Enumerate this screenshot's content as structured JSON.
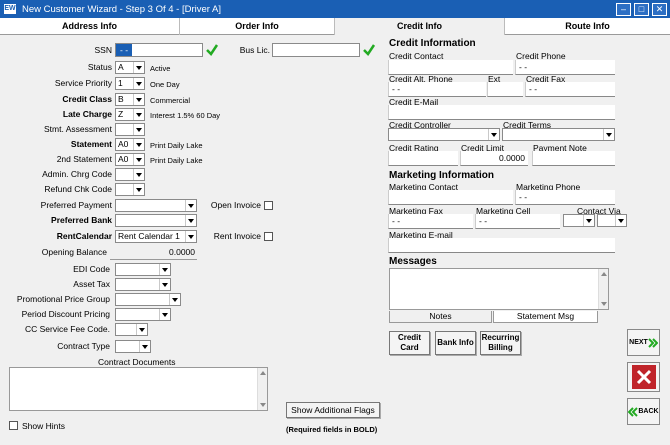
{
  "window": {
    "title": "New Customer Wizard - Step 3 Of 4 - [Driver A]",
    "app_icon": "EW",
    "colors": {
      "titlebar": "#1a5fb4",
      "check": "#22aa22",
      "close": "#c0242a"
    }
  },
  "tabs": [
    "Address Info",
    "Order Info",
    "Credit Info",
    "Route Info"
  ],
  "left": {
    "ssn_label": "SSN",
    "ssn_value": "- -",
    "bus_lic_label": "Bus Lic.",
    "status": {
      "label": "Status",
      "value": "A",
      "desc": "Active"
    },
    "service_priority": {
      "label": "Service Priority",
      "value": "1",
      "desc": "One Day"
    },
    "credit_class": {
      "label": "Credit Class",
      "value": "B",
      "desc": "Commercial"
    },
    "late_charge": {
      "label": "Late Charge",
      "value": "Z",
      "desc": "Interest 1.5% 60 Day"
    },
    "stmt_assessment": {
      "label": "Stmt. Assessment"
    },
    "statement": {
      "label": "Statement",
      "value": "A0",
      "desc": "Print Daily Lake"
    },
    "second_statement": {
      "label": "2nd Statement",
      "value": "A0",
      "desc": "Print Daily Lake"
    },
    "admin_chrg": {
      "label": "Admin. Chrg Code"
    },
    "refund_chk": {
      "label": "Refund Chk Code"
    },
    "preferred_payment": {
      "label": "Preferred Payment"
    },
    "preferred_bank": {
      "label": "Preferred Bank"
    },
    "rent_calendar": {
      "label": "RentCalendar",
      "value": "Rent Calendar 1"
    },
    "open_invoice": "Open Invoice",
    "rent_invoice": "Rent Invoice",
    "opening_balance": {
      "label": "Opening Balance",
      "value": "0.0000"
    },
    "edi_code": {
      "label": "EDI Code"
    },
    "asset_tax": {
      "label": "Asset Tax"
    },
    "promo_price_group": {
      "label": "Promotional Price Group"
    },
    "period_discount": {
      "label": "Period Discount Pricing"
    },
    "cc_service_fee": {
      "label": "CC Service Fee Code."
    },
    "contract_type": {
      "label": "Contract Type"
    },
    "contract_documents": "Contract Documents",
    "show_hints": "Show Hints"
  },
  "credit": {
    "title": "Credit Information",
    "contact": "Credit Contact",
    "phone": "Credit Phone",
    "phone_value": "- -",
    "alt_phone": "Credit Alt. Phone",
    "alt_phone_value": "- -",
    "ext": "Ext",
    "fax": "Credit Fax",
    "fax_value": "- -",
    "email": "Credit E-Mail",
    "controller": "Credit Controller",
    "terms": "Credit Terms",
    "rating": "Credit Rating",
    "limit": "Credit Limit",
    "limit_value": "0.0000",
    "payment_note": "Payment Note"
  },
  "marketing": {
    "title": "Marketing Information",
    "contact": "Marketing Contact",
    "phone": "Marketing Phone",
    "phone_value": "- -",
    "fax": "Marketing Fax",
    "fax_value": "- -",
    "cell": "Marketing Cell",
    "cell_value": "- -",
    "contact_via": "Contact Via",
    "email": "Marketing E-mail"
  },
  "messages": {
    "title": "Messages",
    "notes_label": "Notes",
    "statement_msg_label": "Statement Msg"
  },
  "buttons": {
    "credit_card": "Credit Card",
    "bank_info": "Bank Info",
    "recurring_billing": "Recurring Billing",
    "show_flags": "Show Additional Flags",
    "next": "NEXT",
    "back": "BACK"
  },
  "footer_note": "(Required fields in BOLD)"
}
